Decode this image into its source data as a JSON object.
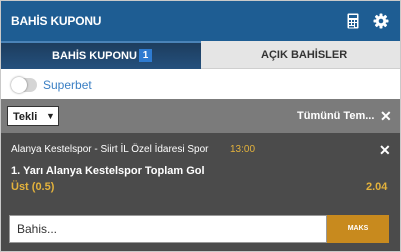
{
  "header": {
    "title": "BAHİS KUPONU",
    "icons": [
      "calculator-icon",
      "gear-icon"
    ]
  },
  "tabs": [
    {
      "label": "BAHİS KUPONU",
      "badge": "1",
      "active": true
    },
    {
      "label": "AÇIK BAHİSLER",
      "active": false
    }
  ],
  "superbet": {
    "label": "Superbet",
    "enabled": false
  },
  "bet_type": {
    "selected": "Tekli",
    "clear_label": "Tümünü Tem..."
  },
  "coupon": {
    "match": "Alanya Kestelspor - Siirt İL Özel İdaresi Spor",
    "time": "13:00",
    "market": "1. Yarı Alanya Kestelspor Toplam Gol",
    "selection": "Üst (0.5)",
    "odds": "2.04"
  },
  "stake": {
    "placeholder": "Bahis...",
    "max_label": "MAKS"
  },
  "colors": {
    "header": "#1e5d93",
    "tab_active": "#24507d",
    "badge": "#2e7bd1",
    "accent": "#e3b23c",
    "max_button": "#c88a1e",
    "panel": "#4b4b4b",
    "bar": "#7b7b7b",
    "link": "#3a7fc4"
  }
}
